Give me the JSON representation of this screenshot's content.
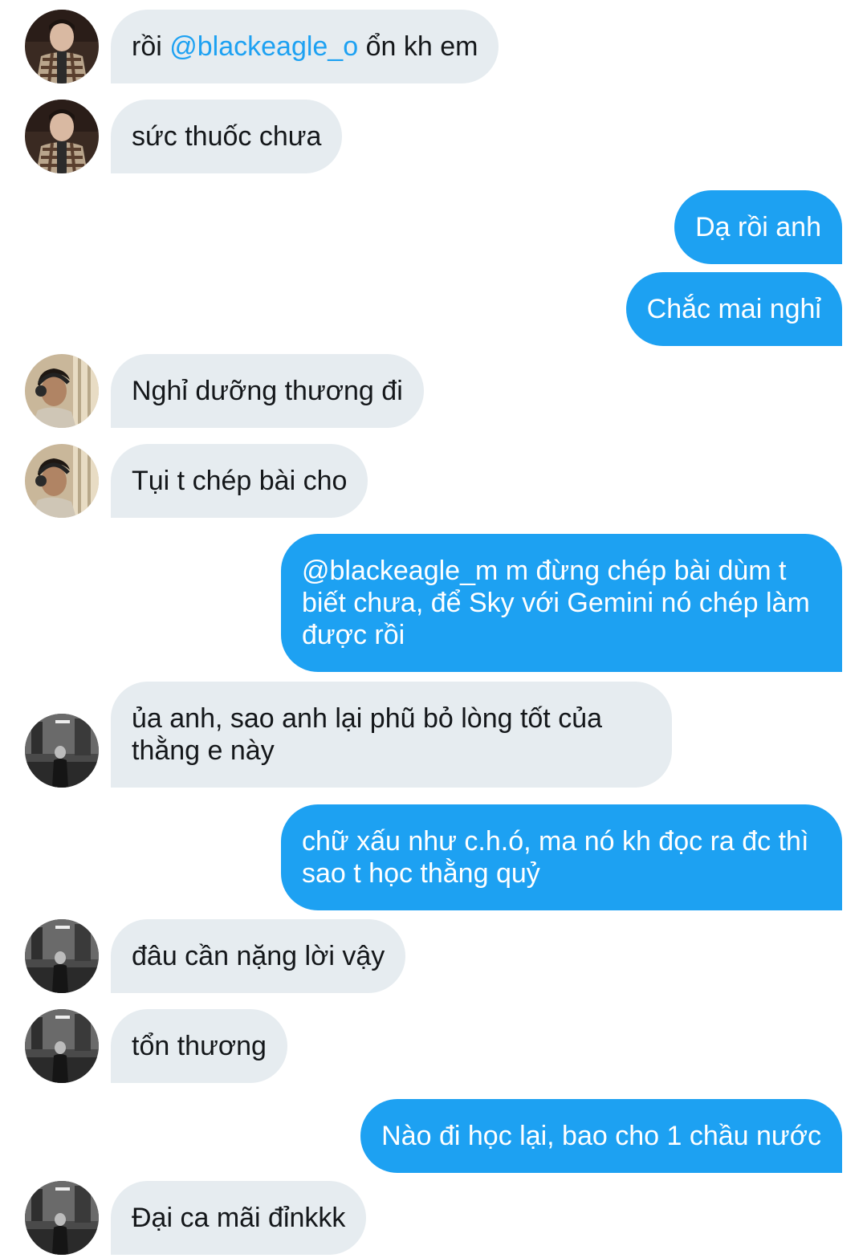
{
  "messages": [
    {
      "id": 1,
      "direction": "in",
      "avatar": "avatar-plaid-person",
      "parts": [
        {
          "text": "rồi "
        },
        {
          "text": "@blackeagle_o",
          "mention": true
        },
        {
          "text": " ổn kh em"
        }
      ]
    },
    {
      "id": 2,
      "direction": "in",
      "avatar": "avatar-plaid-person",
      "text": "sức thuốc chưa"
    },
    {
      "id": 3,
      "direction": "out",
      "text": "Dạ rồi anh"
    },
    {
      "id": 4,
      "direction": "out",
      "text": "Chắc mai nghỉ"
    },
    {
      "id": 5,
      "direction": "in",
      "avatar": "avatar-headphones-person",
      "text": "Nghỉ dưỡng thương đi"
    },
    {
      "id": 6,
      "direction": "in",
      "avatar": "avatar-headphones-person",
      "text": "Tụi t chép bài cho"
    },
    {
      "id": 7,
      "direction": "out",
      "text": "@blackeagle_m m đừng chép bài dùm t biết chưa, để Sky với Gemini nó chép làm được rồi"
    },
    {
      "id": 8,
      "direction": "in",
      "avatar": "avatar-street-bw-person",
      "text": "ủa anh, sao anh lại phũ bỏ lòng tốt của thằng e này"
    },
    {
      "id": 9,
      "direction": "out",
      "text": "chữ xấu như c.h.ó, ma nó kh đọc ra đc thì sao t học thằng quỷ"
    },
    {
      "id": 10,
      "direction": "in",
      "avatar": "avatar-street-bw-person",
      "text": "đâu cần nặng lời vậy"
    },
    {
      "id": 11,
      "direction": "in",
      "avatar": "avatar-street-bw-person",
      "text": "tổn thương"
    },
    {
      "id": 12,
      "direction": "out",
      "text": "Nào đi học lại, bao cho 1 chầu nước"
    },
    {
      "id": 13,
      "direction": "in",
      "avatar": "avatar-street-bw-person",
      "text": "Đại ca mãi đỉnkkk"
    }
  ],
  "colors": {
    "incoming_bubble": "#e6ecf0",
    "incoming_text": "#14171a",
    "outgoing_bubble": "#1da1f2",
    "outgoing_text": "#ffffff",
    "mention": "#1da1f2"
  }
}
